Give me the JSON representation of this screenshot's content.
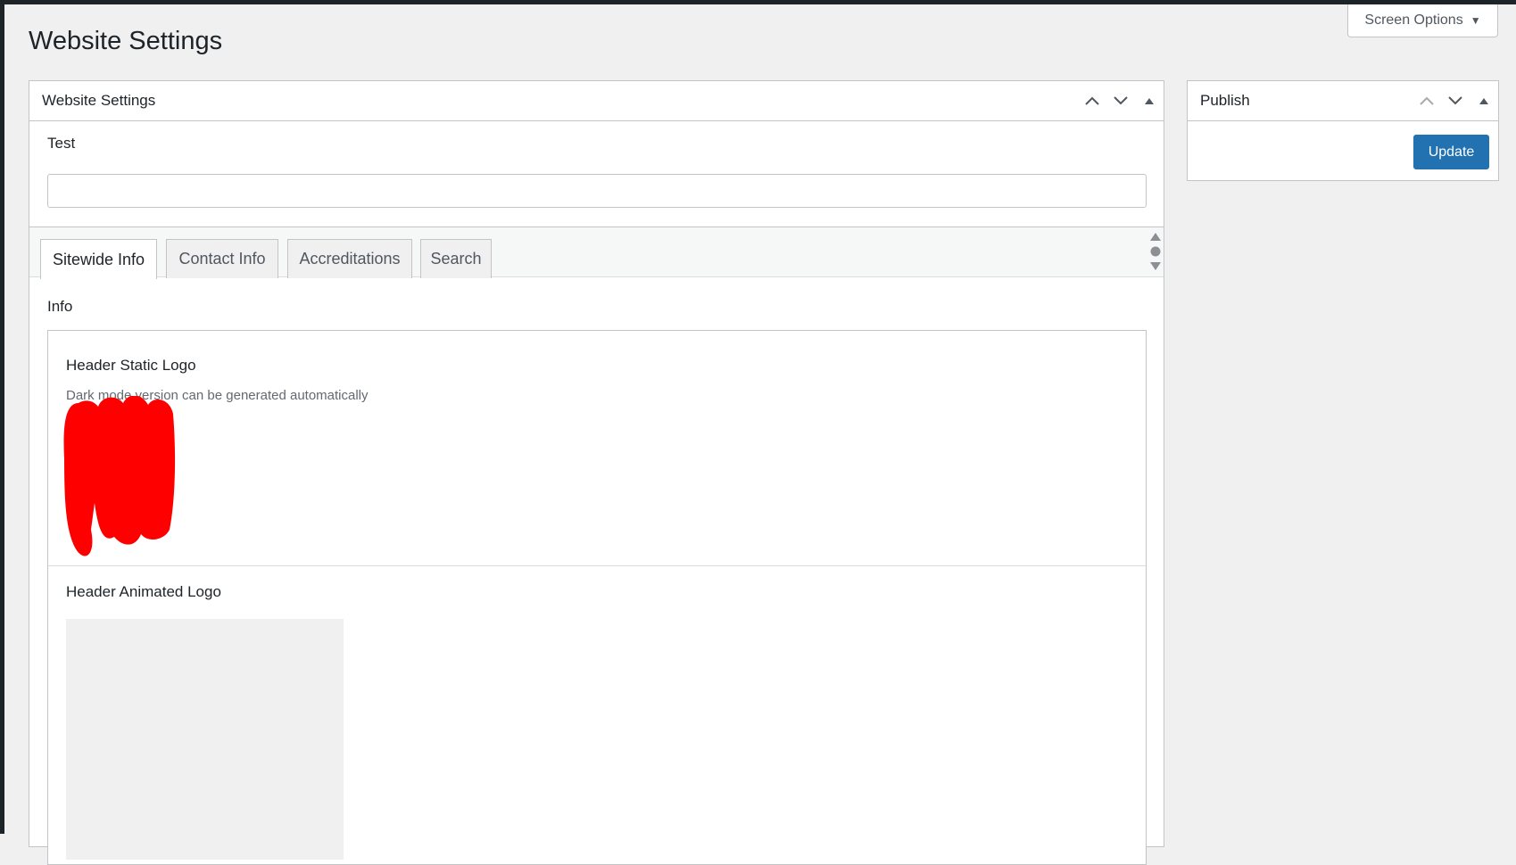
{
  "screen_options": {
    "label": "Screen Options",
    "icon": "caret-down-icon"
  },
  "page": {
    "title": "Website Settings"
  },
  "main_box": {
    "title": "Website Settings",
    "test_field": {
      "label": "Test",
      "value": "",
      "placeholder": ""
    },
    "tabs": [
      {
        "label": "Sitewide Info",
        "active": true
      },
      {
        "label": "Contact Info",
        "active": false
      },
      {
        "label": "Accreditations",
        "active": false
      },
      {
        "label": "Search",
        "active": false
      }
    ],
    "section_label": "Info",
    "header_static_logo": {
      "label": "Header Static Logo",
      "description": "Dark mode version can be generated automatically"
    },
    "header_animated_logo": {
      "label": "Header Animated Logo"
    }
  },
  "publish_box": {
    "title": "Publish",
    "update_label": "Update"
  },
  "colors": {
    "primary": "#2271b1",
    "redaction": "#ff0000",
    "background": "#f0f0f1"
  }
}
